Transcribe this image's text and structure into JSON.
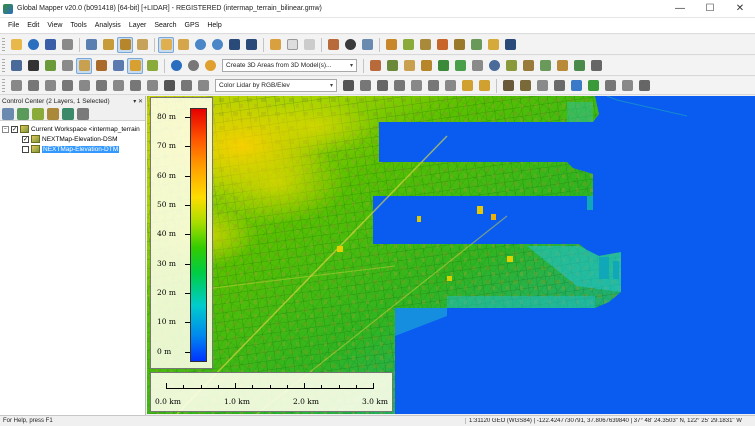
{
  "window": {
    "title": "Global Mapper v20.0 (b091418) [64-bit] [+LIDAR] - REGISTERED (intermap_terrain_bilinear.gmw)",
    "minimize": "—",
    "maximize": "☐",
    "close": "✕"
  },
  "menu": [
    "File",
    "Edit",
    "View",
    "Tools",
    "Analysis",
    "Layer",
    "Search",
    "GPS",
    "Help"
  ],
  "toolbar": {
    "create_3d_combo": "Create 3D Areas from 3D Model(s)...",
    "lidar_color_combo": "Color Lidar by RGB/Elev",
    "icons": {
      "row1": [
        "open-icon",
        "globe-icon",
        "save-icon",
        "print-icon",
        "layers-icon",
        "config-icon",
        "overview-icon",
        "digitizer-icon",
        "pan-icon",
        "zoom-in-icon",
        "zoom-out-icon",
        "back-icon",
        "home-icon",
        "pencil-icon",
        "delete-icon",
        "measure-icon",
        "info-icon",
        "search-icon",
        "terrain-3d-icon"
      ],
      "row2": [
        "grid-icon",
        "arrow-icon",
        "move-icon",
        "select-icon",
        "feature-icon",
        "dem-icon",
        "paint-icon",
        "path-profile-icon",
        "3d-view-icon",
        "sun-icon",
        "filter-icon",
        "draw-icon"
      ],
      "row3": [
        "lidar-tool-icon",
        "classify-icon",
        "filter-points-icon",
        "profile-icon",
        "building-icon",
        "tree-icon",
        "water-icon",
        "power-line-icon"
      ]
    },
    "colors": {
      "accent": "#3399ff",
      "pressed": "#c8dcf0"
    }
  },
  "control_center": {
    "header": "Control Center (2 Layers, 1 Selected)",
    "header_controls": "▾ ✕",
    "workspace": "Current Workspace <intermap_terrain",
    "layers": [
      {
        "name": "NEXTMap-Elevation-DSM",
        "checked": "✓",
        "selected": false
      },
      {
        "name": "NEXTMap-Elevation-DTM",
        "checked": "",
        "selected": true
      }
    ],
    "workspace_checked": "✓",
    "expand": "−"
  },
  "legend": {
    "ticks": [
      "80 m",
      "70 m",
      "60 m",
      "50 m",
      "40 m",
      "30 m",
      "20 m",
      "10 m",
      "0 m"
    ],
    "colors": [
      "#e60000",
      "#ff9900",
      "#ffdd00",
      "#33cc00",
      "#00cccc",
      "#0033ff"
    ]
  },
  "scalebar": {
    "labels": [
      "0.0 km",
      "1.0 km",
      "2.0 km",
      "3.0 km"
    ]
  },
  "status": {
    "help": "For Help, press F1",
    "coords": "1:31120  GEO (WGS84) | -122.4247730791, 37.8067639840 | 37° 48' 24.3503\" N, 122° 25' 29.1831\" W"
  }
}
